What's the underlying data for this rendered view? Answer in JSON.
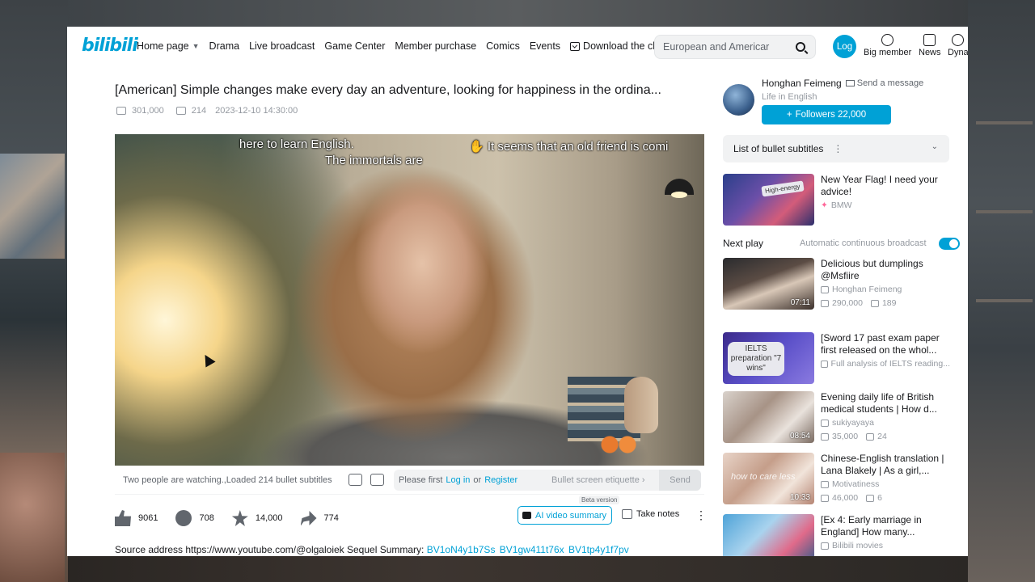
{
  "logo": "bilibili",
  "nav": {
    "items": [
      "Home page",
      "Drama",
      "Live broadcast",
      "Game Center",
      "Member purchase",
      "Comics",
      "Events",
      "Download the client"
    ]
  },
  "search": {
    "value": "European and Americar"
  },
  "header_right": {
    "login": "Log",
    "big_member": "Big member",
    "news": "News",
    "dynamic": "Dyna"
  },
  "video": {
    "title": "[American] Simple changes make every day an adventure, looking for happiness in the ordina...",
    "views": "301,000",
    "danmaku_count": "214",
    "date": "2023-12-10 14:30:00",
    "danmaku": [
      "here to learn English.",
      "The immortals are",
      "It seems that an old friend is comi"
    ]
  },
  "bullet_bar": {
    "watching": "Two  people are watching.,Loaded 214 bullet subtitles",
    "placeholder_pre": "Please first",
    "login": "Log in",
    "or": "or",
    "register": "Register",
    "etiquette": "Bullet screen etiquette",
    "send": "Send"
  },
  "actions": {
    "likes": "9061",
    "coins": "708",
    "favorites": "14,000",
    "shares": "774",
    "ai_summary": "AI video summary",
    "beta": "Beta version",
    "notes": "Take notes"
  },
  "source": {
    "text": "Source address https://www.youtube.com/@olgaloiek Sequel Summary:",
    "links": [
      "BV1oN4y1b7Ss",
      "BV1gw411t76x",
      "BV1tp4y1f7pv"
    ]
  },
  "uploader": {
    "name": "Honghan Feimeng",
    "send_message": "Send a message",
    "desc": "Life in English",
    "follow": "Followers 22,000"
  },
  "danmu_list": {
    "label": "List of bullet subtitles"
  },
  "ad": {
    "title": "New Year Flag! I need your advice!",
    "brand": "BMW",
    "thumb_label": "High-energy"
  },
  "next_play": {
    "label": "Next play",
    "auto": "Automatic continuous broadcast"
  },
  "recommendations": [
    {
      "title": "Delicious but dumplings @Msfiire",
      "up": "Honghan Feimeng",
      "views": "290,000",
      "danmaku": "189",
      "duration": "07:11"
    },
    {
      "title": "[Sword 17 past exam paper first released on the whol...",
      "up": "Full analysis of IELTS reading...",
      "views": "",
      "danmaku": "",
      "duration": "",
      "thumb_label": "IELTS preparation \"7 wins\""
    },
    {
      "title": "Evening daily life of British medical students | How d...",
      "up": "sukiyayaya",
      "views": "35,000",
      "danmaku": "24",
      "duration": "08:54"
    },
    {
      "title": "Chinese-English translation | Lana Blakely | As a girl,...",
      "up": "Motivatiness",
      "views": "46,000",
      "danmaku": "6",
      "duration": "10:33",
      "thumb_label": "how to care less"
    },
    {
      "title": "[Ex 4: Early marriage in England] How many...",
      "up": "Bilibili movies",
      "views": "",
      "danmaku": "",
      "duration": ""
    }
  ]
}
